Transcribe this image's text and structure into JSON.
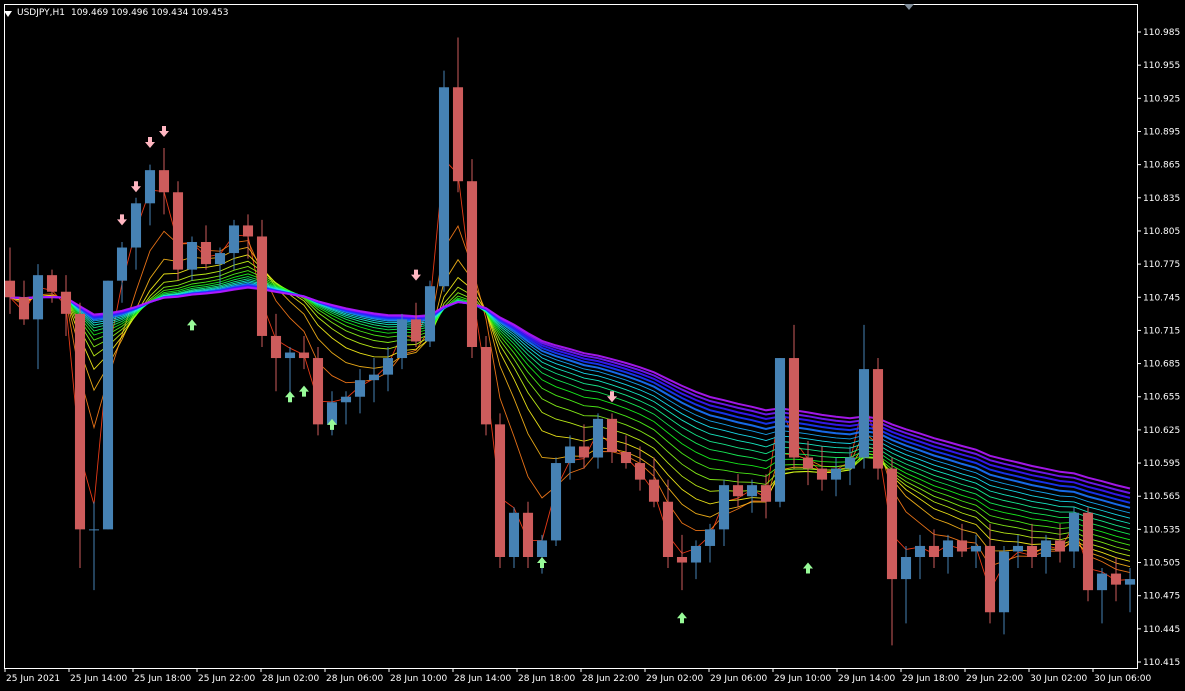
{
  "window": {
    "symbol": "USDJPY,H1",
    "ohlc": "109.469 109.496 109.434 109.453"
  },
  "colors": {
    "background": "#000000",
    "frame": "#ffffff",
    "bull_candle": "#4682b4",
    "bear_candle": "#cd5c5c",
    "buy_arrow": "#98fb98",
    "sell_arrow": "#ffb6c1"
  },
  "chart_data": {
    "type": "candlestick",
    "y_axis": {
      "range": [
        110.4,
        111.0
      ],
      "ticks": [
        "110.985",
        "110.955",
        "110.925",
        "110.895",
        "110.865",
        "110.835",
        "110.805",
        "110.775",
        "110.745",
        "110.715",
        "110.685",
        "110.655",
        "110.625",
        "110.595",
        "110.565",
        "110.535",
        "110.505",
        "110.475",
        "110.445",
        "110.415"
      ]
    },
    "x_axis": {
      "ticks": [
        "25 Jun 2021",
        "25 Jun 14:00",
        "25 Jun 18:00",
        "25 Jun 22:00",
        "28 Jun 02:00",
        "28 Jun 06:00",
        "28 Jun 10:00",
        "28 Jun 14:00",
        "28 Jun 18:00",
        "28 Jun 22:00",
        "29 Jun 02:00",
        "29 Jun 06:00",
        "29 Jun 10:00",
        "29 Jun 14:00",
        "29 Jun 18:00",
        "29 Jun 22:00",
        "30 Jun 02:00",
        "30 Jun 06:00"
      ]
    },
    "candles": [
      {
        "o": 110.76,
        "h": 110.79,
        "l": 110.73,
        "c": 110.745
      },
      {
        "o": 110.745,
        "h": 110.76,
        "l": 110.72,
        "c": 110.725
      },
      {
        "o": 110.725,
        "h": 110.775,
        "l": 110.68,
        "c": 110.765
      },
      {
        "o": 110.765,
        "h": 110.77,
        "l": 110.74,
        "c": 110.75
      },
      {
        "o": 110.75,
        "h": 110.765,
        "l": 110.71,
        "c": 110.73
      },
      {
        "o": 110.73,
        "h": 110.74,
        "l": 110.5,
        "c": 110.535
      },
      {
        "o": 110.535,
        "h": 110.56,
        "l": 110.48,
        "c": 110.535
      },
      {
        "o": 110.535,
        "h": 110.76,
        "l": 110.535,
        "c": 110.76
      },
      {
        "o": 110.76,
        "h": 110.795,
        "l": 110.74,
        "c": 110.79
      },
      {
        "o": 110.79,
        "h": 110.835,
        "l": 110.77,
        "c": 110.83
      },
      {
        "o": 110.83,
        "h": 110.865,
        "l": 110.81,
        "c": 110.86
      },
      {
        "o": 110.86,
        "h": 110.88,
        "l": 110.82,
        "c": 110.84
      },
      {
        "o": 110.84,
        "h": 110.85,
        "l": 110.76,
        "c": 110.77
      },
      {
        "o": 110.77,
        "h": 110.8,
        "l": 110.76,
        "c": 110.795
      },
      {
        "o": 110.795,
        "h": 110.81,
        "l": 110.77,
        "c": 110.775
      },
      {
        "o": 110.775,
        "h": 110.79,
        "l": 110.755,
        "c": 110.785
      },
      {
        "o": 110.785,
        "h": 110.815,
        "l": 110.77,
        "c": 110.81
      },
      {
        "o": 110.81,
        "h": 110.82,
        "l": 110.78,
        "c": 110.8
      },
      {
        "o": 110.8,
        "h": 110.815,
        "l": 110.7,
        "c": 110.71
      },
      {
        "o": 110.71,
        "h": 110.73,
        "l": 110.66,
        "c": 110.69
      },
      {
        "o": 110.69,
        "h": 110.7,
        "l": 110.65,
        "c": 110.695
      },
      {
        "o": 110.695,
        "h": 110.71,
        "l": 110.68,
        "c": 110.69
      },
      {
        "o": 110.69,
        "h": 110.7,
        "l": 110.62,
        "c": 110.63
      },
      {
        "o": 110.63,
        "h": 110.66,
        "l": 110.62,
        "c": 110.65
      },
      {
        "o": 110.65,
        "h": 110.66,
        "l": 110.63,
        "c": 110.655
      },
      {
        "o": 110.655,
        "h": 110.68,
        "l": 110.64,
        "c": 110.67
      },
      {
        "o": 110.67,
        "h": 110.69,
        "l": 110.65,
        "c": 110.675
      },
      {
        "o": 110.675,
        "h": 110.7,
        "l": 110.66,
        "c": 110.69
      },
      {
        "o": 110.69,
        "h": 110.73,
        "l": 110.68,
        "c": 110.725
      },
      {
        "o": 110.725,
        "h": 110.74,
        "l": 110.7,
        "c": 110.705
      },
      {
        "o": 110.705,
        "h": 110.76,
        "l": 110.7,
        "c": 110.755
      },
      {
        "o": 110.755,
        "h": 110.95,
        "l": 110.75,
        "c": 110.935
      },
      {
        "o": 110.935,
        "h": 110.98,
        "l": 110.84,
        "c": 110.85
      },
      {
        "o": 110.85,
        "h": 110.87,
        "l": 110.69,
        "c": 110.7
      },
      {
        "o": 110.7,
        "h": 110.71,
        "l": 110.62,
        "c": 110.63
      },
      {
        "o": 110.63,
        "h": 110.64,
        "l": 110.5,
        "c": 110.51
      },
      {
        "o": 110.51,
        "h": 110.555,
        "l": 110.5,
        "c": 110.55
      },
      {
        "o": 110.55,
        "h": 110.56,
        "l": 110.5,
        "c": 110.51
      },
      {
        "o": 110.51,
        "h": 110.53,
        "l": 110.495,
        "c": 110.525
      },
      {
        "o": 110.525,
        "h": 110.6,
        "l": 110.52,
        "c": 110.595
      },
      {
        "o": 110.595,
        "h": 110.62,
        "l": 110.58,
        "c": 110.61
      },
      {
        "o": 110.61,
        "h": 110.63,
        "l": 110.59,
        "c": 110.6
      },
      {
        "o": 110.6,
        "h": 110.64,
        "l": 110.59,
        "c": 110.635
      },
      {
        "o": 110.635,
        "h": 110.64,
        "l": 110.595,
        "c": 110.605
      },
      {
        "o": 110.605,
        "h": 110.62,
        "l": 110.59,
        "c": 110.595
      },
      {
        "o": 110.595,
        "h": 110.61,
        "l": 110.57,
        "c": 110.58
      },
      {
        "o": 110.58,
        "h": 110.6,
        "l": 110.555,
        "c": 110.56
      },
      {
        "o": 110.56,
        "h": 110.58,
        "l": 110.5,
        "c": 110.51
      },
      {
        "o": 110.51,
        "h": 110.53,
        "l": 110.48,
        "c": 110.505
      },
      {
        "o": 110.505,
        "h": 110.525,
        "l": 110.49,
        "c": 110.52
      },
      {
        "o": 110.52,
        "h": 110.54,
        "l": 110.505,
        "c": 110.535
      },
      {
        "o": 110.535,
        "h": 110.58,
        "l": 110.52,
        "c": 110.575
      },
      {
        "o": 110.575,
        "h": 110.585,
        "l": 110.555,
        "c": 110.565
      },
      {
        "o": 110.565,
        "h": 110.58,
        "l": 110.55,
        "c": 110.575
      },
      {
        "o": 110.575,
        "h": 110.585,
        "l": 110.545,
        "c": 110.56
      },
      {
        "o": 110.56,
        "h": 110.69,
        "l": 110.555,
        "c": 110.69
      },
      {
        "o": 110.69,
        "h": 110.72,
        "l": 110.59,
        "c": 110.6
      },
      {
        "o": 110.6,
        "h": 110.615,
        "l": 110.575,
        "c": 110.59
      },
      {
        "o": 110.59,
        "h": 110.61,
        "l": 110.57,
        "c": 110.58
      },
      {
        "o": 110.58,
        "h": 110.6,
        "l": 110.565,
        "c": 110.59
      },
      {
        "o": 110.59,
        "h": 110.61,
        "l": 110.575,
        "c": 110.6
      },
      {
        "o": 110.6,
        "h": 110.72,
        "l": 110.59,
        "c": 110.68
      },
      {
        "o": 110.68,
        "h": 110.69,
        "l": 110.58,
        "c": 110.59
      },
      {
        "o": 110.59,
        "h": 110.6,
        "l": 110.43,
        "c": 110.49
      },
      {
        "o": 110.49,
        "h": 110.52,
        "l": 110.45,
        "c": 110.51
      },
      {
        "o": 110.51,
        "h": 110.53,
        "l": 110.49,
        "c": 110.52
      },
      {
        "o": 110.52,
        "h": 110.535,
        "l": 110.5,
        "c": 110.51
      },
      {
        "o": 110.51,
        "h": 110.53,
        "l": 110.495,
        "c": 110.525
      },
      {
        "o": 110.525,
        "h": 110.54,
        "l": 110.51,
        "c": 110.515
      },
      {
        "o": 110.515,
        "h": 110.53,
        "l": 110.5,
        "c": 110.52
      },
      {
        "o": 110.52,
        "h": 110.54,
        "l": 110.45,
        "c": 110.46
      },
      {
        "o": 110.46,
        "h": 110.52,
        "l": 110.44,
        "c": 110.515
      },
      {
        "o": 110.515,
        "h": 110.53,
        "l": 110.5,
        "c": 110.52
      },
      {
        "o": 110.52,
        "h": 110.54,
        "l": 110.5,
        "c": 110.51
      },
      {
        "o": 110.51,
        "h": 110.53,
        "l": 110.495,
        "c": 110.525
      },
      {
        "o": 110.525,
        "h": 110.54,
        "l": 110.505,
        "c": 110.515
      },
      {
        "o": 110.515,
        "h": 110.555,
        "l": 110.5,
        "c": 110.55
      },
      {
        "o": 110.55,
        "h": 110.555,
        "l": 110.47,
        "c": 110.48
      },
      {
        "o": 110.48,
        "h": 110.5,
        "l": 110.45,
        "c": 110.495
      },
      {
        "o": 110.495,
        "h": 110.51,
        "l": 110.47,
        "c": 110.485
      },
      {
        "o": 110.485,
        "h": 110.5,
        "l": 110.46,
        "c": 110.49
      }
    ],
    "buy_arrows": [
      {
        "i": 13,
        "y": 110.725
      },
      {
        "i": 20,
        "y": 110.66
      },
      {
        "i": 21,
        "y": 110.665
      },
      {
        "i": 23,
        "y": 110.635
      },
      {
        "i": 38,
        "y": 110.51
      },
      {
        "i": 48,
        "y": 110.46
      },
      {
        "i": 57,
        "y": 110.505
      }
    ],
    "sell_arrows": [
      {
        "i": 9,
        "y": 110.84
      },
      {
        "i": 10,
        "y": 110.88
      },
      {
        "i": 11,
        "y": 110.89
      },
      {
        "i": 8,
        "y": 110.81
      },
      {
        "i": 29,
        "y": 110.76
      },
      {
        "i": 43,
        "y": 110.65
      }
    ]
  }
}
